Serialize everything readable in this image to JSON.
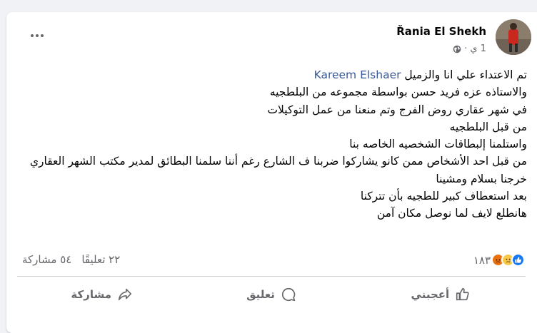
{
  "post": {
    "author": "Řania El Shekh",
    "time": "1 ي",
    "privacy_icon": "globe-icon",
    "text_lines": [
      {
        "prefix": "تم الاعتداء علي انا والزميل ",
        "mention": "Kareem Elshaer"
      },
      {
        "text": "والاستاذه عزه فريد حسن بواسطة مجموعه من البلطجيه"
      },
      {
        "text": " في شهر عقاري روض الفرج وتم منعنا من عمل التوكيلات"
      },
      {
        "text": "من قبل البلطجيه"
      },
      {
        "text": " واستلمنا إلبطاقات الشخصيه الخاصه بنا"
      },
      {
        "text": "من قبل احد الأشخاص ممن كانو يشاركوا ضربنا ف الشارع رغم أننا سلمنا البطائق لمدير مكتب الشهر العقاري"
      },
      {
        "text": "خرجنا بسلام ومشينا"
      },
      {
        "text": "بعد استعطاف كبير للطجيه بأن تتركنا"
      },
      {
        "text": "هانطلع لايف لما نوصل مكان آمن"
      }
    ]
  },
  "stats": {
    "reactions_count": "١٨٣",
    "reaction_icons": [
      "like-icon",
      "sad-icon",
      "angry-icon"
    ],
    "comments": "٢٢ تعليقًا",
    "shares": "٥٤ مشاركة"
  },
  "actions": {
    "like": "أعجبني",
    "comment": "تعليق",
    "share": "مشاركة"
  },
  "colors": {
    "link": "#385898",
    "secondary_text": "#65676b",
    "like_blue": "#1877f2",
    "sad_yellow": "#f7c84a",
    "angry_red": "#e9710f"
  }
}
